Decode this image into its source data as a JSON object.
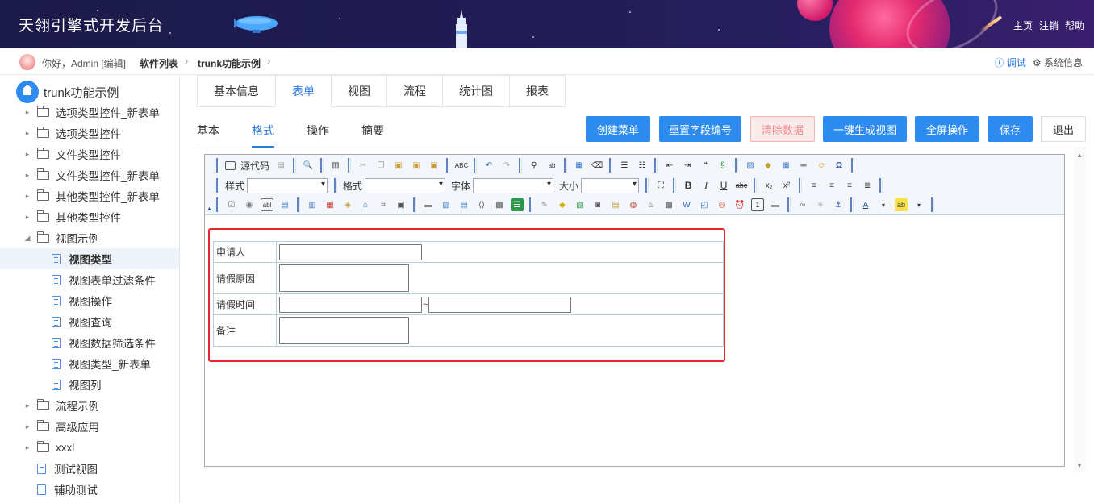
{
  "header": {
    "title": "天翎引擎式开发后台",
    "nav": [
      "主页",
      "注销",
      "帮助"
    ]
  },
  "crumbbar": {
    "greeting": "你好，Admin [编辑]",
    "crumbs": [
      "软件列表",
      "trunk功能示例"
    ],
    "debug_label": "调试",
    "sysinfo_label": "系统信息"
  },
  "sidebar": {
    "root": "trunk功能示例",
    "items": [
      {
        "label": "选项类型控件_新表单",
        "type": "folder"
      },
      {
        "label": "选项类型控件",
        "type": "folder"
      },
      {
        "label": "文件类型控件",
        "type": "folder"
      },
      {
        "label": "文件类型控件_新表单",
        "type": "folder"
      },
      {
        "label": "其他类型控件_新表单",
        "type": "folder"
      },
      {
        "label": "其他类型控件",
        "type": "folder"
      },
      {
        "label": "视图示例",
        "type": "folder-open"
      },
      {
        "label": "视图类型",
        "type": "doc-child",
        "active": true
      },
      {
        "label": "视图表单过滤条件",
        "type": "doc-child"
      },
      {
        "label": "视图操作",
        "type": "doc-child"
      },
      {
        "label": "视图查询",
        "type": "doc-child"
      },
      {
        "label": "视图数据筛选条件",
        "type": "doc-child"
      },
      {
        "label": "视图类型_新表单",
        "type": "doc-child"
      },
      {
        "label": "视图列",
        "type": "doc-child"
      },
      {
        "label": "流程示例",
        "type": "folder"
      },
      {
        "label": "高级应用",
        "type": "folder"
      },
      {
        "label": "xxxl",
        "type": "folder"
      },
      {
        "label": "测试视图",
        "type": "doc"
      },
      {
        "label": "辅助测试",
        "type": "doc"
      }
    ]
  },
  "tabs": [
    "基本信息",
    "表单",
    "视图",
    "流程",
    "统计图",
    "报表"
  ],
  "active_tab": "表单",
  "subtabs": [
    "基本",
    "格式",
    "操作",
    "摘要"
  ],
  "active_subtab": "格式",
  "actions": {
    "create_menu": "创建菜单",
    "reset_field_numbers": "重置字段编号",
    "clear_data": "清除数据",
    "generate_view": "一键生成视图",
    "fullscreen": "全屏操作",
    "save": "保存",
    "exit": "退出"
  },
  "editor": {
    "source_label": "源代码",
    "style_label": "样式",
    "format_label": "格式",
    "font_label": "字体",
    "size_label": "大小",
    "form_fields": [
      {
        "label": "申请人",
        "kind": "input"
      },
      {
        "label": "请假原因",
        "kind": "textarea"
      },
      {
        "label": "请假时间",
        "kind": "range",
        "separator": "~"
      },
      {
        "label": "备注",
        "kind": "textarea"
      }
    ]
  },
  "colors": {
    "accent": "#2e8cf0",
    "header_bg": "#1c1a4a",
    "highlight_border": "#e8262d",
    "danger_button_bg": "#fbeaea"
  }
}
